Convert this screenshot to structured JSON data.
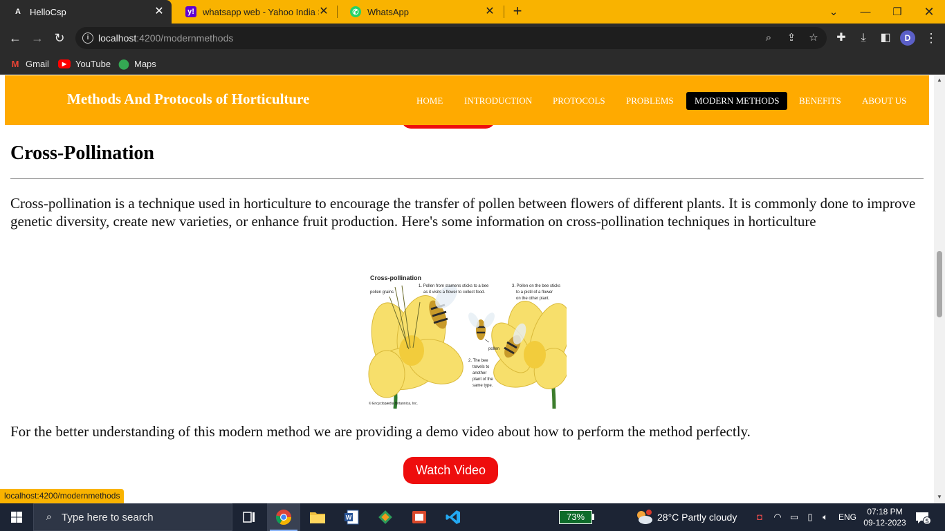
{
  "browser": {
    "tabs": [
      {
        "title": "HelloCsp",
        "favicon": "angular-icon",
        "active": true
      },
      {
        "title": "whatsapp web - Yahoo India Sea",
        "favicon": "yahoo-icon",
        "active": false
      },
      {
        "title": "WhatsApp",
        "favicon": "whatsapp-icon",
        "active": false
      }
    ],
    "url_host": "localhost",
    "url_path": ":4200/modernmethods",
    "profile_initial": "D",
    "bookmarks": [
      {
        "label": "Gmail",
        "icon": "gmail-icon"
      },
      {
        "label": "YouTube",
        "icon": "youtube-icon"
      },
      {
        "label": "Maps",
        "icon": "maps-icon"
      }
    ],
    "status_url": "localhost:4200/modernmethods"
  },
  "site": {
    "brand": "Methods And Protocols of Horticulture",
    "nav": [
      {
        "label": "HOME",
        "active": false
      },
      {
        "label": "INTRODUCTION",
        "active": false
      },
      {
        "label": "PROTOCOLS",
        "active": false
      },
      {
        "label": "PROBLEMS",
        "active": false
      },
      {
        "label": "MODERN METHODS",
        "active": true
      },
      {
        "label": "BENEFITS",
        "active": false
      },
      {
        "label": "ABOUT US",
        "active": false
      }
    ],
    "colors": {
      "nav_bg": "#ffaa00",
      "button_red": "#ee0d0d",
      "browser_accent": "#f9b300"
    }
  },
  "content": {
    "heading": "Cross-Pollination",
    "paragraph": "Cross-pollination is a technique used in horticulture to encourage the transfer of pollen between flowers of different plants. It is commonly done to improve genetic diversity, create new varieties, or enhance fruit production. Here's some information on cross-pollination techniques in horticulture",
    "figure": {
      "title": "Cross-pollination",
      "label_pollen_grains": "pollen grains",
      "step1_line1": "1. Pollen from stamens sticks to a bee",
      "step1_line2": "as it visits a flower to collect food.",
      "step3_line1": "3. Pollen on the bee sticks",
      "step3_line2": "to a pistil of a flower",
      "step3_line3": "on the other plant.",
      "label_pollen": "pollen",
      "step2_line1": "2. The bee",
      "step2_line2": "travels to",
      "step2_line3": "another",
      "step2_line4": "plant of the",
      "step2_line5": "same type.",
      "credit": "© Encyclopædia Britannica, Inc."
    },
    "demo_text": "For the better understanding of this modern method we are providing a demo video about how to perform the method perfectly.",
    "watch_button": "Watch Video"
  },
  "taskbar": {
    "search_placeholder": "Type here to search",
    "battery": "73%",
    "weather": "28°C  Partly cloudy",
    "language": "ENG",
    "time": "07:18 PM",
    "date": "09-12-2023",
    "notifications": "5"
  }
}
